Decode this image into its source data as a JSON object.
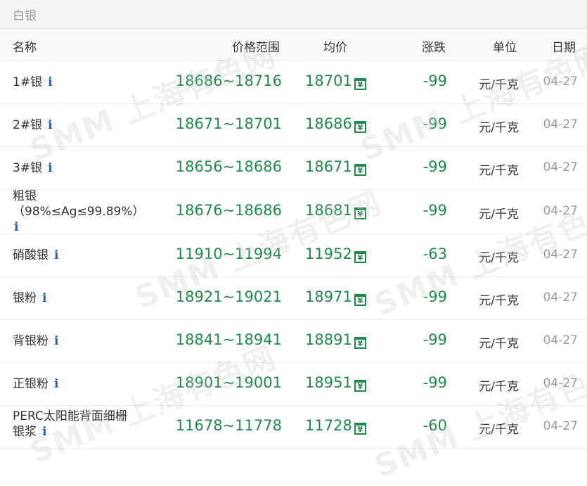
{
  "title": "白银",
  "headers": {
    "name": "名称",
    "range": "价格范围",
    "avg": "均价",
    "change": "涨跌",
    "unit": "单位",
    "date": "日期"
  },
  "watermark": "SMM 上海有色网",
  "rows": [
    {
      "name": "1#银",
      "name2": "",
      "range": "18686~18716",
      "avg": "18701",
      "change": "-99",
      "unit": "元/千克",
      "date": "04-27"
    },
    {
      "name": "2#银",
      "name2": "",
      "range": "18671~18701",
      "avg": "18686",
      "change": "-99",
      "unit": "元/千克",
      "date": "04-27"
    },
    {
      "name": "3#银",
      "name2": "",
      "range": "18656~18686",
      "avg": "18671",
      "change": "-99",
      "unit": "元/千克",
      "date": "04-27"
    },
    {
      "name": "粗银",
      "name2": "（98%≤Ag≤99.89%）",
      "range": "18676~18686",
      "avg": "18681",
      "change": "-99",
      "unit": "元/千克",
      "date": "04-27"
    },
    {
      "name": "硝酸银",
      "name2": "",
      "range": "11910~11994",
      "avg": "11952",
      "change": "-63",
      "unit": "元/千克",
      "date": "04-27"
    },
    {
      "name": "银粉",
      "name2": "",
      "range": "18921~19021",
      "avg": "18971",
      "change": "-99",
      "unit": "元/千克",
      "date": "04-27"
    },
    {
      "name": "背银粉",
      "name2": "",
      "range": "18841~18941",
      "avg": "18891",
      "change": "-99",
      "unit": "元/千克",
      "date": "04-27"
    },
    {
      "name": "正银粉",
      "name2": "",
      "range": "18901~19001",
      "avg": "18951",
      "change": "-99",
      "unit": "元/千克",
      "date": "04-27"
    },
    {
      "name": "PERC太阳能背面细栅",
      "name2": "银浆",
      "range": "11678~11778",
      "avg": "11728",
      "change": "-60",
      "unit": "元/千克",
      "date": "04-27"
    }
  ],
  "icons": {
    "info": "info-icon",
    "calendar": "calendar-icon"
  },
  "colors": {
    "price": "#1f8a4c",
    "info": "#2a5ca8",
    "muted": "#999999"
  }
}
